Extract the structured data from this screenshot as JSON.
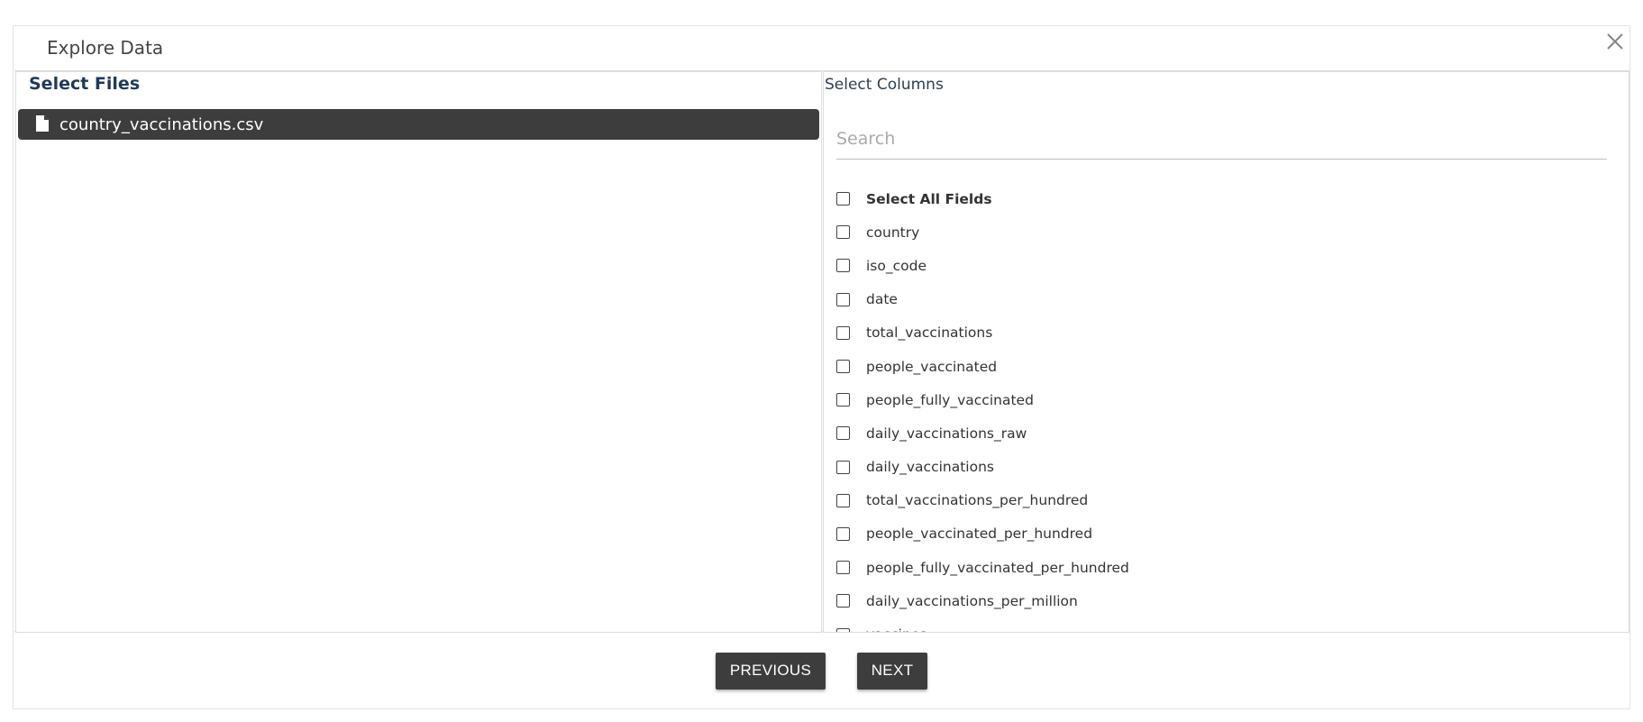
{
  "dialog": {
    "title": "Explore Data",
    "close_icon": "close-icon"
  },
  "files_pane": {
    "title": "Select Files",
    "files": [
      {
        "name": "country_vaccinations.csv",
        "icon": "file-icon",
        "selected": true
      }
    ]
  },
  "columns_pane": {
    "title": "Select Columns",
    "search": {
      "placeholder": "Search",
      "value": ""
    },
    "select_all_label": "Select All Fields",
    "fields": [
      "country",
      "iso_code",
      "date",
      "total_vaccinations",
      "people_vaccinated",
      "people_fully_vaccinated",
      "daily_vaccinations_raw",
      "daily_vaccinations",
      "total_vaccinations_per_hundred",
      "people_vaccinated_per_hundred",
      "people_fully_vaccinated_per_hundred",
      "daily_vaccinations_per_million",
      "vaccines"
    ]
  },
  "footer": {
    "previous_label": "PREVIOUS",
    "next_label": "NEXT"
  },
  "colors": {
    "button_bg": "#3d3d3d",
    "selected_file_bg": "#3d3d3d",
    "title_blue": "#1f3a5a"
  }
}
